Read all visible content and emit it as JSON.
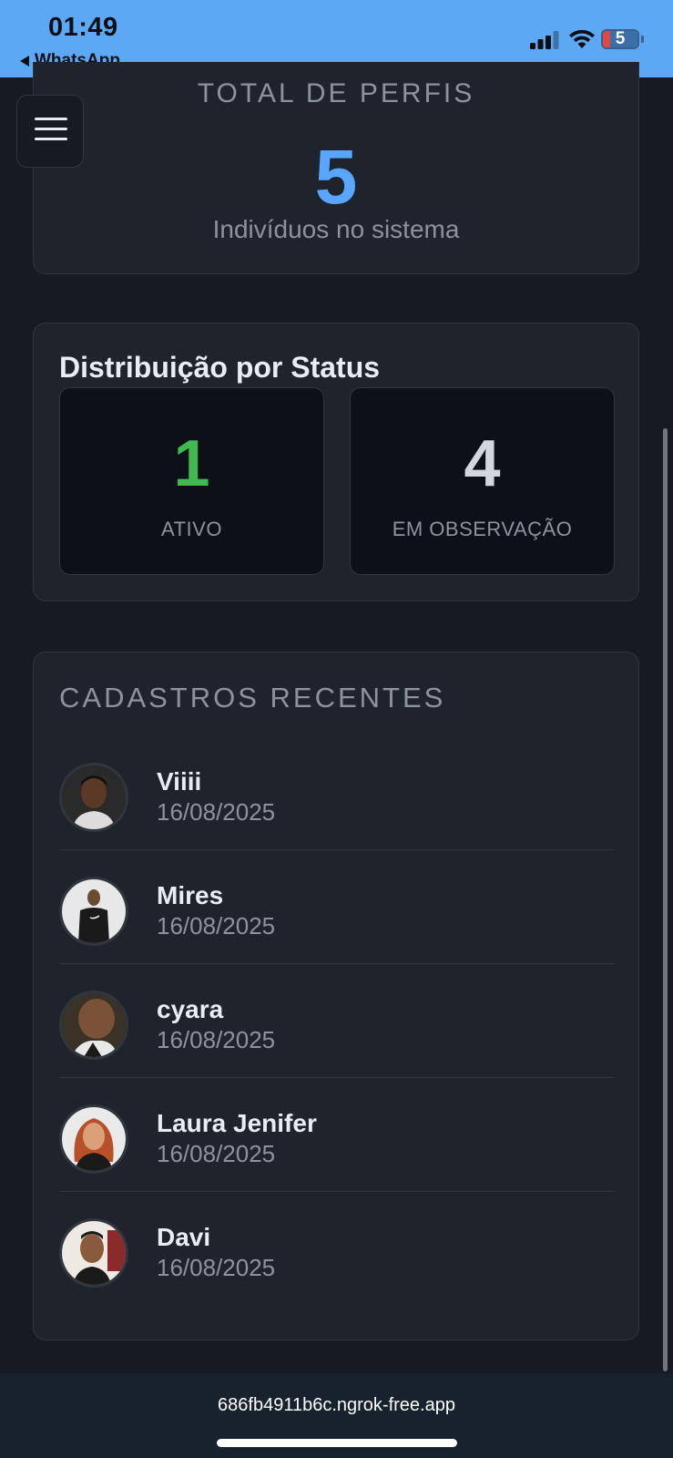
{
  "status_bar": {
    "time": "01:49",
    "back_app": "WhatsApp",
    "battery": "5"
  },
  "total_card": {
    "label": "TOTAL DE PERFIS",
    "value": "5",
    "caption": "Indivíduos no sistema"
  },
  "status_card": {
    "title": "Distribuição por Status",
    "stats": [
      {
        "value": "1",
        "label": "ATIVO",
        "color": "#3fb950"
      },
      {
        "value": "4",
        "label": "EM OBSERVAÇÃO",
        "color": "#d0d7de"
      }
    ]
  },
  "recent_card": {
    "title": "CADASTROS RECENTES",
    "items": [
      {
        "name": "Viiii",
        "date": "16/08/2025"
      },
      {
        "name": "Mires",
        "date": "16/08/2025"
      },
      {
        "name": "cyara",
        "date": "16/08/2025"
      },
      {
        "name": "Laura Jenifer",
        "date": "16/08/2025"
      },
      {
        "name": "Davi",
        "date": "16/08/2025"
      }
    ]
  },
  "browser": {
    "url": "686fb4911b6c.ngrok-free.app"
  },
  "colors": {
    "accent": "#58a6ff",
    "status_bar": "#5da8f5",
    "background": "#161b22"
  }
}
